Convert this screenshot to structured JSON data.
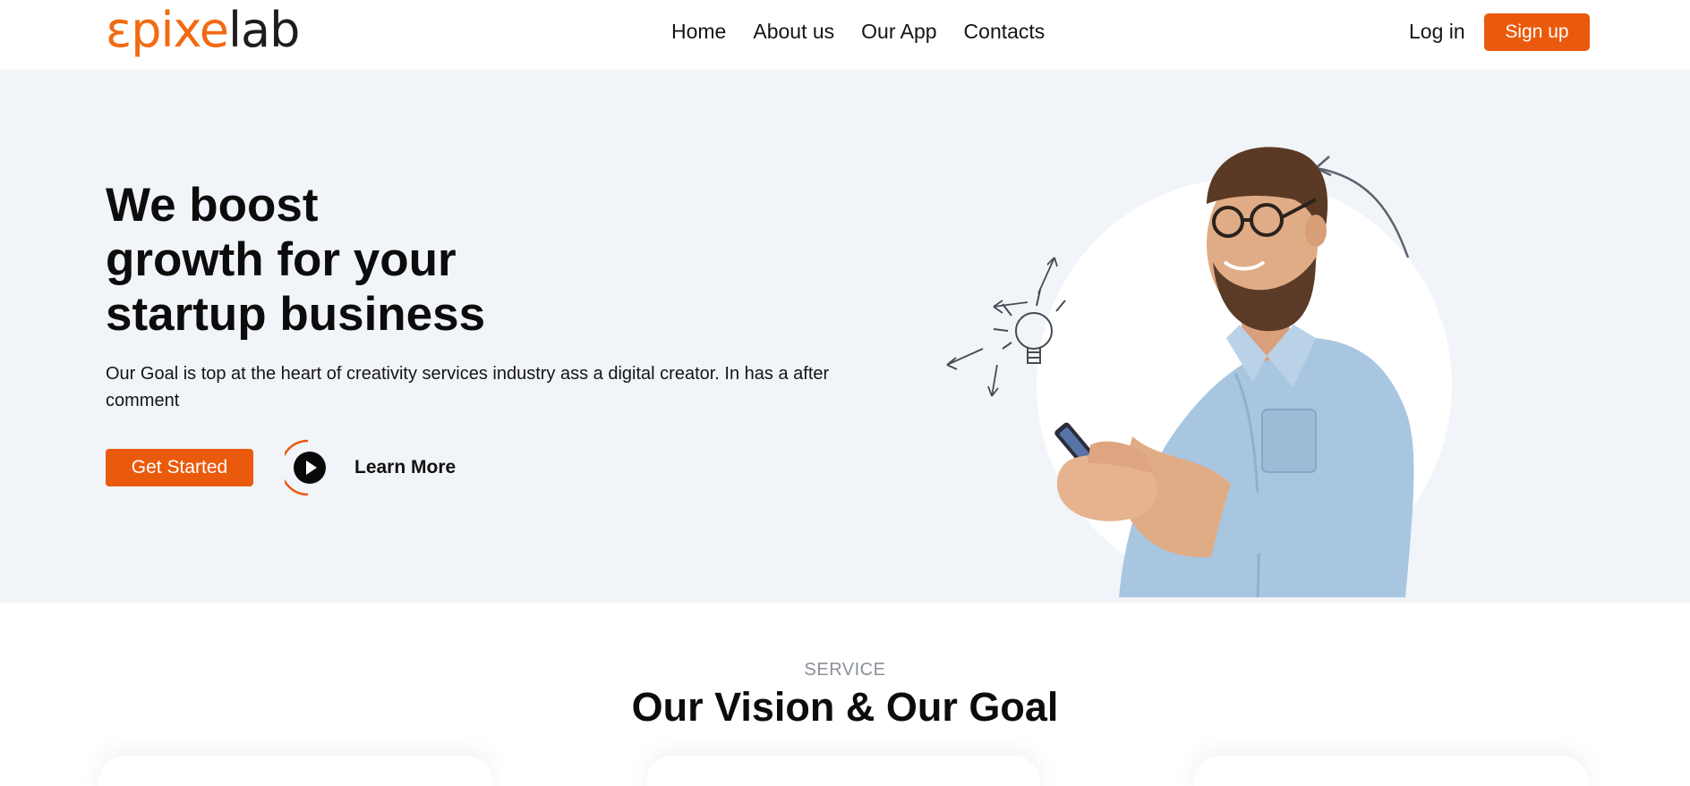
{
  "header": {
    "logo_part1": "ɛpixe",
    "logo_part2": "lab",
    "nav": [
      "Home",
      "About us",
      "Our App",
      "Contacts"
    ],
    "login_label": "Log in",
    "signup_label": "Sign up"
  },
  "hero": {
    "title_lines": [
      "We boost",
      "growth for your",
      "startup business"
    ],
    "description": "Our Goal is top at the heart of creativity services industry ass a digital creator. In has a after comment",
    "primary_cta": "Get Started",
    "secondary_cta": "Learn More",
    "illustration": "man-with-phone-illustration"
  },
  "service": {
    "eyebrow": "SERVICE",
    "title": "Our Vision & Our Goal"
  },
  "colors": {
    "accent": "#ea5a0c",
    "hero_bg": "#f1f4f8",
    "text": "#111111",
    "muted": "#8a8f99"
  }
}
